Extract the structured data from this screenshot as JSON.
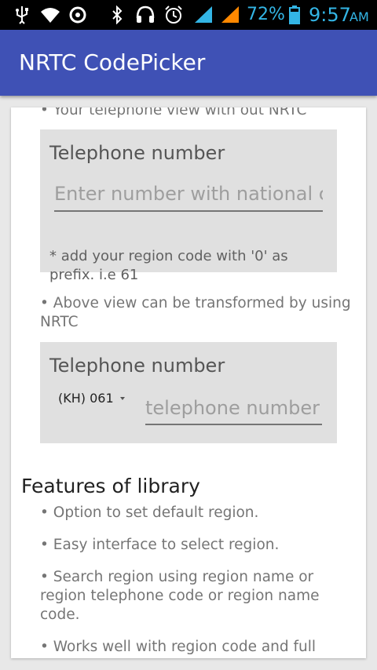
{
  "status_bar": {
    "battery_percent": "72%",
    "time": "9:57",
    "ampm": "AM",
    "icons": [
      "usb-icon",
      "wifi-icon",
      "sync-icon",
      "bluetooth-icon",
      "headset-icon",
      "alarm-icon",
      "signal-icon",
      "signal-2-icon",
      "battery-icon"
    ]
  },
  "app_bar": {
    "title": "NRTC CodePicker",
    "color": "#3f51b5"
  },
  "content": {
    "bullet_without": "• Your telephone view with out NRTC",
    "panel1": {
      "title": "Telephone number",
      "placeholder": "Enter number with national code",
      "hint": "* add your region code with '0' as prefix. i.e 61"
    },
    "bullet_transform": "• Above view can be transformed by using NRTC",
    "panel2": {
      "title": "Telephone number",
      "region_label": "(KH)  061",
      "placeholder": "telephone number"
    },
    "features_heading": "Features of library",
    "features": [
      "• Option to set default region.",
      "• Easy interface to select region.",
      "• Search region using region name or region telephone code or region name code.",
      "• Works well with region code and full"
    ]
  }
}
